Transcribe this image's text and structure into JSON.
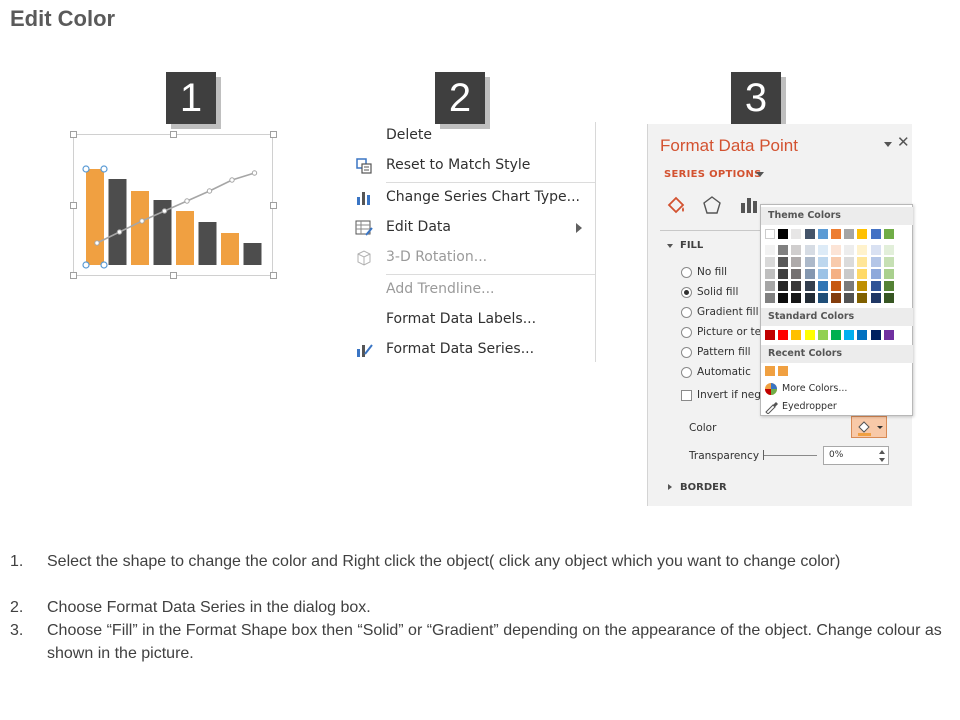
{
  "page_title": "Edit Color",
  "badges": [
    "1",
    "2",
    "3"
  ],
  "chart_thumbnail": {
    "bars": [
      {
        "value": 96,
        "color": "#f0a041"
      },
      {
        "value": 86,
        "color": "#4d4d4d"
      },
      {
        "value": 74,
        "color": "#f0a041"
      },
      {
        "value": 65,
        "color": "#4d4d4d"
      },
      {
        "value": 54,
        "color": "#f0a041"
      },
      {
        "value": 43,
        "color": "#4d4d4d"
      },
      {
        "value": 32,
        "color": "#f0a041"
      },
      {
        "value": 22,
        "color": "#4d4d4d"
      }
    ],
    "line": [
      22,
      33,
      44,
      54,
      64,
      74,
      85,
      92
    ],
    "ymax": 100,
    "line_color": "#a6a6a6",
    "selected_bar_index": 0
  },
  "context_menu": {
    "items": [
      {
        "label": "Delete",
        "icon": "none",
        "disabled": false,
        "submenu": false
      },
      {
        "label": "Reset to Match Style",
        "icon": "reset-style-icon",
        "disabled": false,
        "submenu": false
      },
      {
        "label": "Change Series Chart Type...",
        "icon": "chart-type-icon",
        "disabled": false,
        "submenu": false
      },
      {
        "label": "Edit Data",
        "icon": "edit-data-icon",
        "disabled": false,
        "submenu": true
      },
      {
        "label": "3-D Rotation...",
        "icon": "cube-icon",
        "disabled": true,
        "submenu": false
      },
      {
        "label": "Add Trendline...",
        "icon": "none",
        "disabled": true,
        "submenu": false
      },
      {
        "label": "Format Data Labels...",
        "icon": "none",
        "disabled": false,
        "submenu": false
      },
      {
        "label": "Format Data Series...",
        "icon": "format-series-icon",
        "disabled": false,
        "submenu": false
      }
    ]
  },
  "format_pane": {
    "title": "Format Data Point",
    "series_options": "SERIES OPTIONS",
    "fill_section": "FILL",
    "fill_options": [
      {
        "label": "No fill",
        "selected": false
      },
      {
        "label": "Solid fill",
        "selected": true
      },
      {
        "label": "Gradient fill",
        "selected": false
      },
      {
        "label": "Picture or tex",
        "selected": false
      },
      {
        "label": "Pattern fill",
        "selected": false
      },
      {
        "label": "Automatic",
        "selected": false
      }
    ],
    "invert_label": "Invert if nega",
    "color_label": "Color",
    "transparency_label": "Transparency",
    "transparency_value": "0%",
    "border_section": "BORDER",
    "accent_color": "#d35230"
  },
  "color_popup": {
    "theme_header": "Theme Colors",
    "standard_header": "Standard Colors",
    "recent_header": "Recent Colors",
    "theme_top": [
      "#ffffff",
      "#000000",
      "#e7e6e6",
      "#44546a",
      "#5b9bd5",
      "#ed7d31",
      "#a5a5a5",
      "#ffc000",
      "#4472c4",
      "#70ad47"
    ],
    "theme_shades": [
      [
        "#f2f2f2",
        "#808080",
        "#d0cece",
        "#d6dce4",
        "#ddebf7",
        "#fce4d6",
        "#ededed",
        "#fff2cc",
        "#d9e1f2",
        "#e2efda"
      ],
      [
        "#d9d9d9",
        "#595959",
        "#aeaaaa",
        "#acb9ca",
        "#bdd7ee",
        "#f8cbad",
        "#dbdbdb",
        "#ffe699",
        "#b4c6e7",
        "#c6e0b4"
      ],
      [
        "#bfbfbf",
        "#404040",
        "#757171",
        "#8497b0",
        "#9bc2e6",
        "#f4b084",
        "#c9c9c9",
        "#ffd966",
        "#8ea9db",
        "#a9d08e"
      ],
      [
        "#a6a6a6",
        "#262626",
        "#3a3838",
        "#333f4f",
        "#2f75b5",
        "#c65911",
        "#7b7b7b",
        "#bf8f00",
        "#305496",
        "#548235"
      ],
      [
        "#808080",
        "#0d0d0d",
        "#161616",
        "#222b35",
        "#1f4e78",
        "#833c0c",
        "#525252",
        "#806000",
        "#203764",
        "#375623"
      ]
    ],
    "standard": [
      "#c00000",
      "#ff0000",
      "#ffc000",
      "#ffff00",
      "#92d050",
      "#00b050",
      "#00b0f0",
      "#0070c0",
      "#002060",
      "#7030a0"
    ],
    "recent": [
      "#f0a041",
      "#f0a041"
    ],
    "more_colors": "More Colors...",
    "eyedropper": "Eyedropper"
  },
  "instructions": [
    {
      "num": "1.",
      "text": "Select the shape to change the color and Right click the object( click any object which you want to change color)"
    },
    {
      "num": "2.",
      "text": "Choose Format Data Series in the dialog box."
    },
    {
      "num": "3.",
      "text": "Choose “Fill” in the Format Shape box then  “Solid” or “Gradient” depending on the appearance of the object. Change colour as shown in the picture."
    }
  ]
}
